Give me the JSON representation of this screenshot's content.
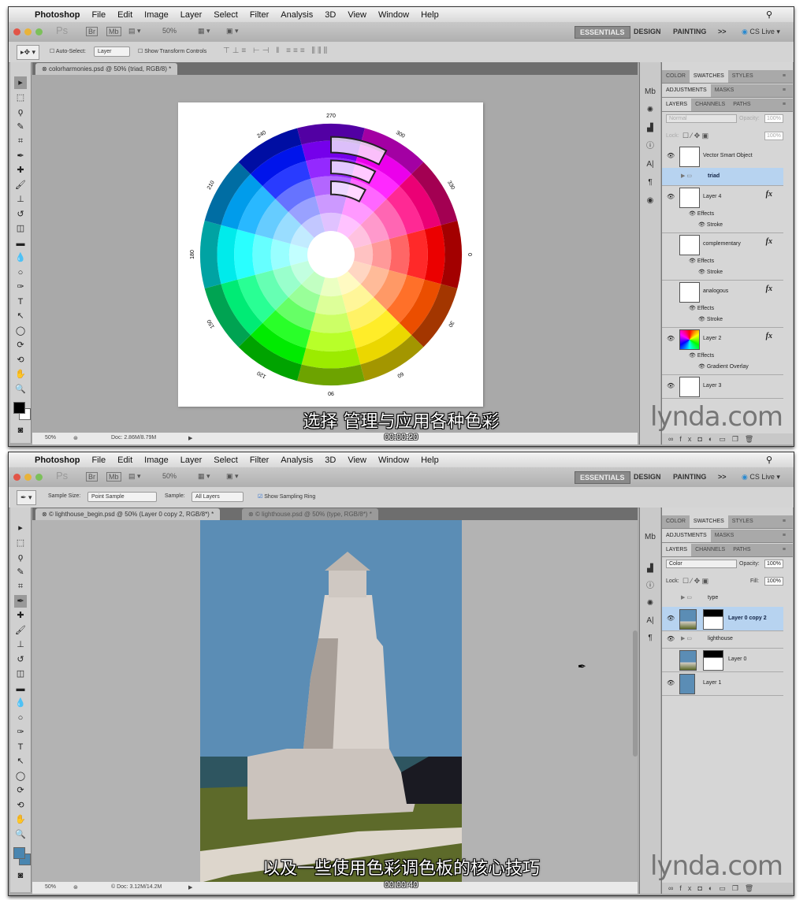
{
  "menubar": {
    "apple": "",
    "app": "Photoshop",
    "items": [
      "File",
      "Edit",
      "Image",
      "Layer",
      "Select",
      "Filter",
      "Analysis",
      "3D",
      "View",
      "Window",
      "Help"
    ],
    "search_icon": "magnifier-icon"
  },
  "appbar": {
    "ps": "Ps",
    "br": "Br",
    "mb": "Mb",
    "zoom": "50%",
    "workspaces": [
      "ESSENTIALS",
      "DESIGN",
      "PAINTING"
    ],
    "more": ">>",
    "cslive": "CS Live"
  },
  "screen1": {
    "options": {
      "auto_select": "Auto-Select:",
      "auto_select_value": "Layer",
      "show_transform": "Show Transform Controls"
    },
    "doc_tab": "colorharmonies.psd @ 50% (triad, RGB/8) *",
    "status": {
      "zoom": "50%",
      "doc": "Doc: 2.86M/8.79M"
    },
    "panel_tabs": {
      "row1": [
        "COLOR",
        "SWATCHES",
        "STYLES"
      ],
      "row2": [
        "ADJUSTMENTS",
        "MASKS"
      ],
      "row3": [
        "LAYERS",
        "CHANNELS",
        "PATHS"
      ]
    },
    "blend_mode": "Normal",
    "opacity_label": "Opacity:",
    "opacity": "100%",
    "lock_label": "Lock:",
    "fill_label": "Fill:",
    "fill": "100%",
    "layers": [
      {
        "name": "Vector Smart Object",
        "visible": true
      },
      {
        "name": "triad",
        "group": true,
        "selected": true
      },
      {
        "name": "Layer 4",
        "visible": true,
        "fx": true,
        "effects": "Effects",
        "effect": "Stroke"
      },
      {
        "name": "complementary",
        "visible": false,
        "fx": true,
        "effects": "Effects",
        "effect": "Stroke"
      },
      {
        "name": "analogous",
        "visible": false,
        "fx": true,
        "effects": "Effects",
        "effect": "Stroke"
      },
      {
        "name": "Layer 2",
        "visible": true,
        "fx": true,
        "effects": "Effects",
        "effect": "Gradient Overlay"
      },
      {
        "name": "Layer 3",
        "visible": true
      }
    ],
    "wheel_labels": [
      "0",
      "30",
      "60",
      "90",
      "120",
      "150",
      "180",
      "210",
      "240",
      "270",
      "300",
      "330"
    ],
    "caption": "选择 管理与应用各种色彩",
    "time": "00:00:20"
  },
  "screen2": {
    "options": {
      "sample_size_label": "Sample Size:",
      "sample_size": "Point Sample",
      "sample_label": "Sample:",
      "sample": "All Layers",
      "show_ring": "Show Sampling Ring",
      "show_ring_checked": true
    },
    "doc_tabs": [
      "© lighthouse_begin.psd @ 50% (Layer 0 copy 2, RGB/8*) *",
      "© lighthouse.psd @ 50% (type, RGB/8*) *"
    ],
    "status": {
      "zoom": "50%",
      "doc": "© Doc: 3.12M/14.2M"
    },
    "blend_mode": "Color",
    "opacity_label": "Opacity:",
    "opacity": "100%",
    "lock_label": "Lock:",
    "fill_label": "Fill:",
    "fill": "100%",
    "layers": [
      {
        "name": "type",
        "group": true,
        "visible": false
      },
      {
        "name": "Layer 0 copy 2",
        "visible": true,
        "selected": true,
        "mask": true
      },
      {
        "name": "lighthouse",
        "group": true,
        "visible": true
      },
      {
        "name": "Layer 0",
        "visible": false,
        "mask": true
      },
      {
        "name": "Layer 1",
        "visible": true
      }
    ],
    "caption": "以及一些使用色彩调色板的核心技巧",
    "time": "00:00:40"
  },
  "watermark": "lynda.com",
  "colors": {
    "foreground1": "#000000",
    "foreground2": "#4a86b0",
    "selection": "#b7d3f0",
    "sky": "#5b8db5"
  }
}
